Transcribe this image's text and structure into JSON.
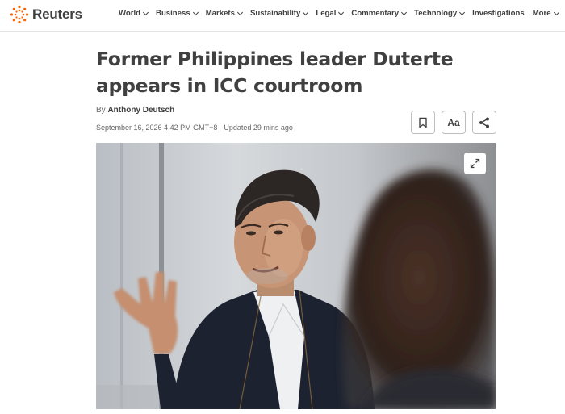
{
  "header": {
    "logo_text": "Reuters",
    "nav": [
      {
        "label": "World",
        "has_dropdown": true
      },
      {
        "label": "Business",
        "has_dropdown": true
      },
      {
        "label": "Markets",
        "has_dropdown": true
      },
      {
        "label": "Sustainability",
        "has_dropdown": true
      },
      {
        "label": "Legal",
        "has_dropdown": true
      },
      {
        "label": "Commentary",
        "has_dropdown": true
      },
      {
        "label": "Technology",
        "has_dropdown": true
      },
      {
        "label": "Investigations",
        "has_dropdown": false
      },
      {
        "label": "More",
        "has_dropdown": true
      }
    ]
  },
  "article": {
    "headline_line1": "Former Philippines leader Duterte",
    "headline_line2": "appears in ICC courtroom",
    "by_prefix": "By",
    "author": "Anthony Deutsch",
    "dateline": "September 16, 2026 4:42 PM GMT+8 · Updated 29 mins ago",
    "font_size_button_label": "Aa"
  },
  "icons": {
    "bookmark": "bookmark-icon",
    "font_size": "font-size-icon",
    "share": "share-icon",
    "expand": "expand-icon"
  },
  "colors": {
    "brand_orange": "#fa6400",
    "text_dark": "#404040",
    "text_muted": "#666666"
  }
}
